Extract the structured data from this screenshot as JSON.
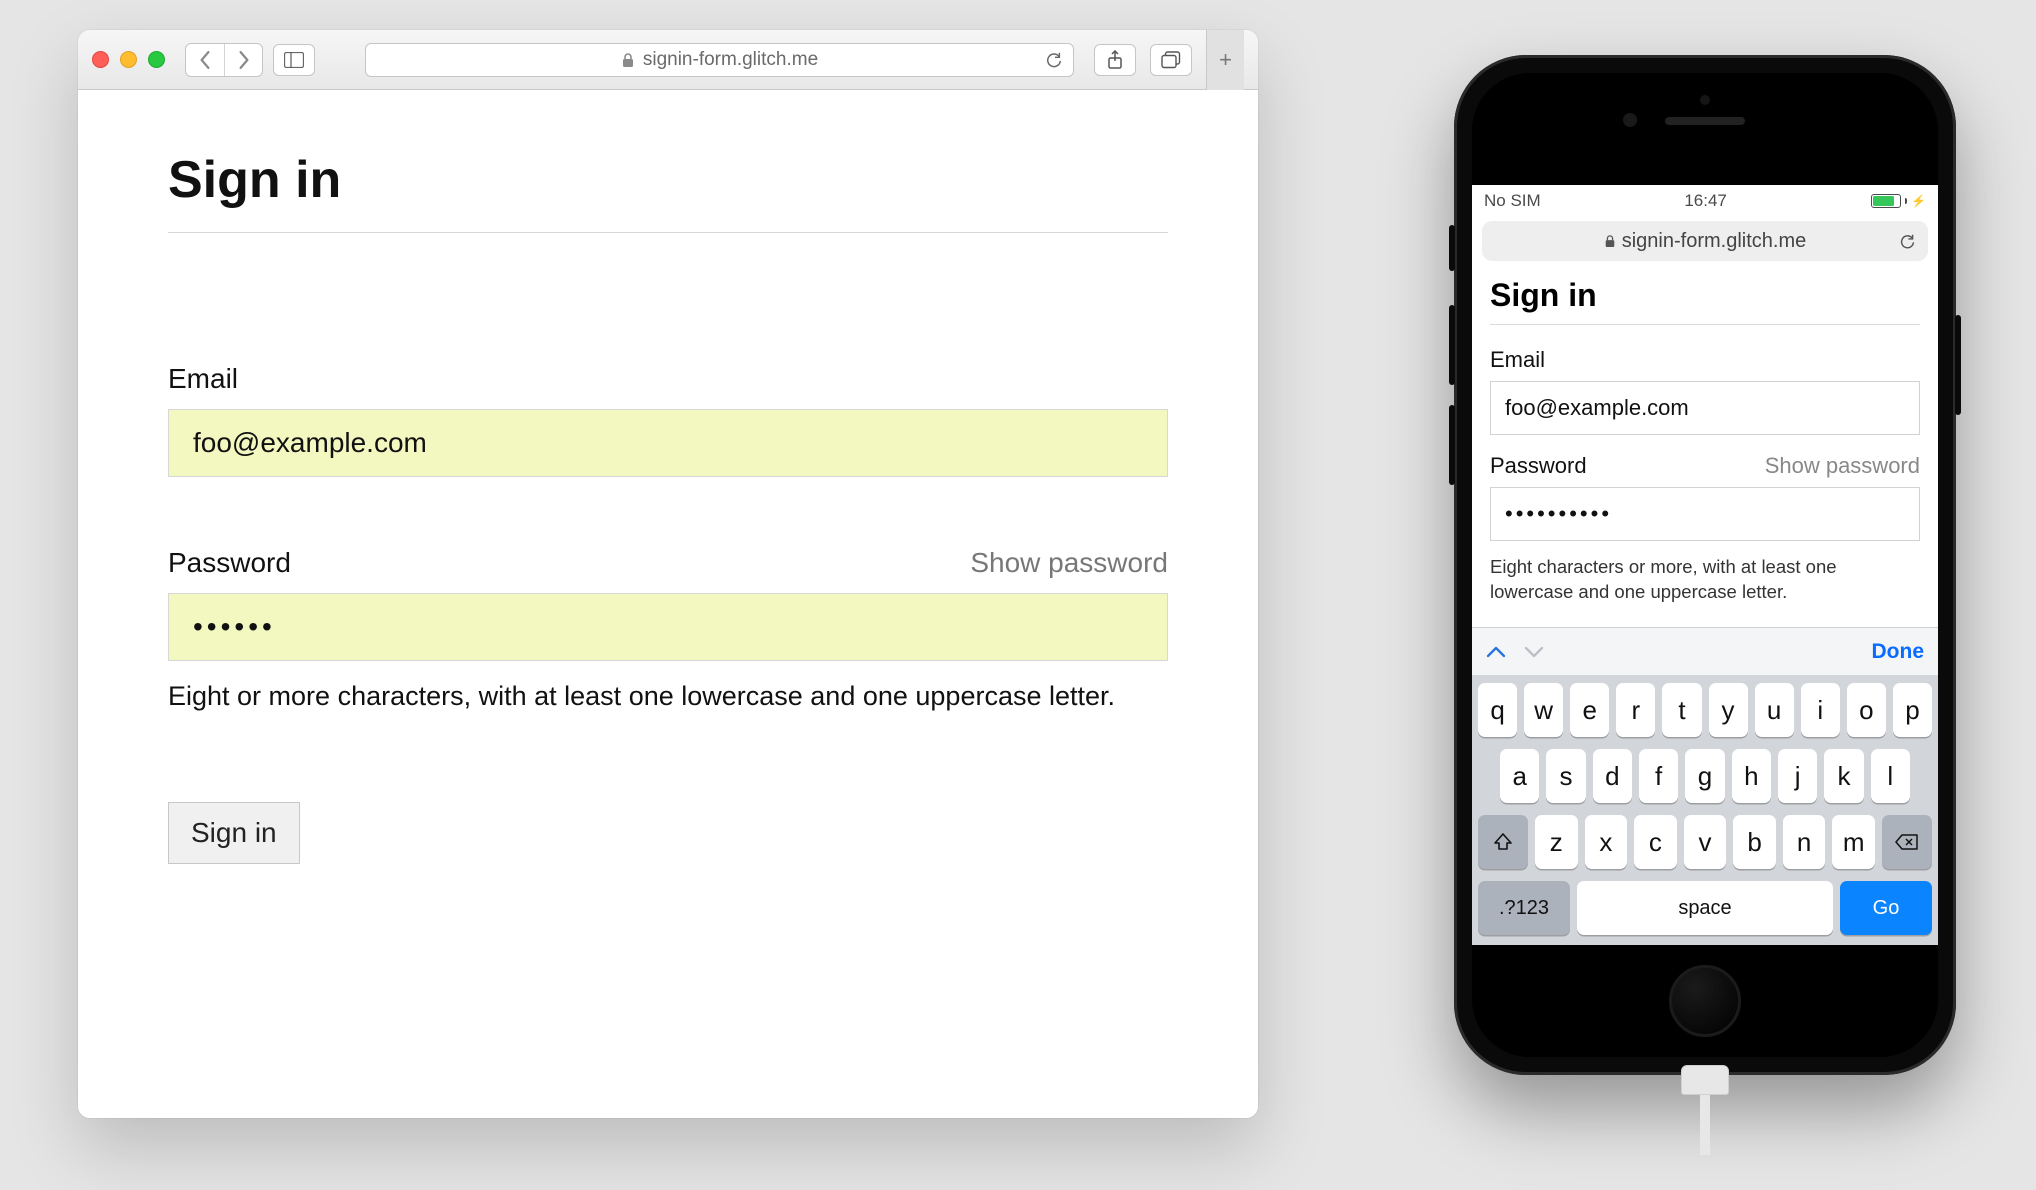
{
  "desktop": {
    "url_host": "signin-form.glitch.me",
    "page": {
      "title": "Sign in",
      "email_label": "Email",
      "email_value": "foo@example.com",
      "password_label": "Password",
      "show_password": "Show password",
      "password_masked": "••••••",
      "password_hint": "Eight or more characters, with at least one lowercase and one uppercase letter.",
      "submit_label": "Sign in"
    }
  },
  "mobile": {
    "status": {
      "carrier": "No SIM",
      "time": "16:47"
    },
    "url_host": "signin-form.glitch.me",
    "page": {
      "title": "Sign in",
      "email_label": "Email",
      "email_value": "foo@example.com",
      "password_label": "Password",
      "show_password": "Show password",
      "password_masked": "••••••••••",
      "password_hint": "Eight characters or more, with at least one lowercase and one uppercase letter."
    },
    "accessory": {
      "done": "Done"
    },
    "keyboard": {
      "row1": [
        "q",
        "w",
        "e",
        "r",
        "t",
        "y",
        "u",
        "i",
        "o",
        "p"
      ],
      "row2": [
        "a",
        "s",
        "d",
        "f",
        "g",
        "h",
        "j",
        "k",
        "l"
      ],
      "row3": [
        "z",
        "x",
        "c",
        "v",
        "b",
        "n",
        "m"
      ],
      "num_label": ".?123",
      "space_label": "space",
      "go_label": "Go"
    }
  }
}
